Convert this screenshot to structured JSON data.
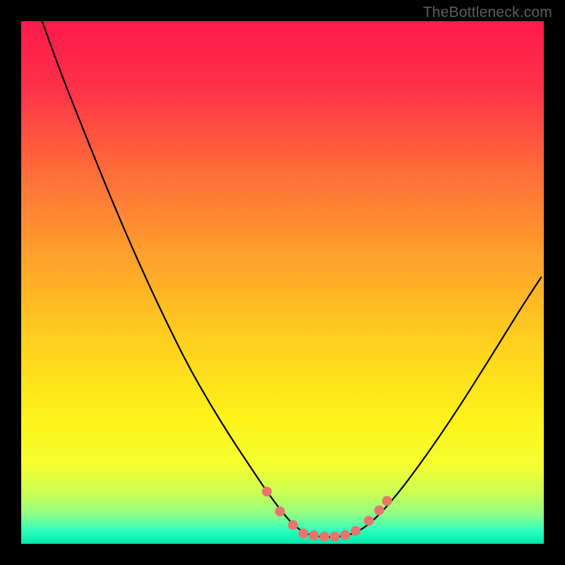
{
  "watermark": "TheBottleneck.com",
  "chart_data": {
    "type": "line",
    "title": "",
    "xlabel": "",
    "ylabel": "",
    "xlim": [
      0,
      100
    ],
    "ylim": [
      0,
      100
    ],
    "grid": false,
    "legend": false,
    "gradient_stops": [
      {
        "offset": 0.0,
        "color": "#ff1a4b"
      },
      {
        "offset": 0.12,
        "color": "#ff2f4a"
      },
      {
        "offset": 0.28,
        "color": "#ff6a3a"
      },
      {
        "offset": 0.45,
        "color": "#ffa12c"
      },
      {
        "offset": 0.62,
        "color": "#ffd21e"
      },
      {
        "offset": 0.76,
        "color": "#fff21a"
      },
      {
        "offset": 0.85,
        "color": "#f4ff30"
      },
      {
        "offset": 0.905,
        "color": "#c8ff55"
      },
      {
        "offset": 0.945,
        "color": "#8dff8a"
      },
      {
        "offset": 0.975,
        "color": "#2dffc0"
      },
      {
        "offset": 1.0,
        "color": "#00e8a8"
      }
    ],
    "series": [
      {
        "name": "bottleneck-curve",
        "stroke": "#000000",
        "stroke_width": 2.2,
        "x": [
          4,
          8,
          12,
          16,
          20,
          24,
          28,
          32,
          36,
          40,
          44,
          47,
          50,
          52,
          54,
          56,
          58,
          60,
          62.5,
          65,
          68,
          72,
          76,
          80,
          84,
          88,
          92,
          96,
          99.5
        ],
        "y": [
          100,
          89,
          79,
          69,
          59.5,
          50.5,
          42,
          34,
          27,
          20.5,
          14.5,
          10,
          6,
          3.7,
          2.2,
          1.5,
          1.3,
          1.3,
          1.6,
          2.6,
          5.0,
          9.5,
          14.8,
          20.5,
          26.5,
          32.8,
          39.2,
          45.7,
          51
        ]
      }
    ],
    "markers": {
      "color": "#e9746d",
      "radius": 7,
      "points": [
        {
          "x": 47.0,
          "y": 10.0
        },
        {
          "x": 49.5,
          "y": 6.2
        },
        {
          "x": 52.0,
          "y": 3.6
        },
        {
          "x": 54.0,
          "y": 2.0
        },
        {
          "x": 56.0,
          "y": 1.6
        },
        {
          "x": 58.0,
          "y": 1.4
        },
        {
          "x": 60.0,
          "y": 1.4
        },
        {
          "x": 62.0,
          "y": 1.7
        },
        {
          "x": 64.0,
          "y": 2.5
        },
        {
          "x": 66.5,
          "y": 4.4
        },
        {
          "x": 68.5,
          "y": 6.4
        },
        {
          "x": 70.0,
          "y": 8.2
        }
      ]
    }
  }
}
